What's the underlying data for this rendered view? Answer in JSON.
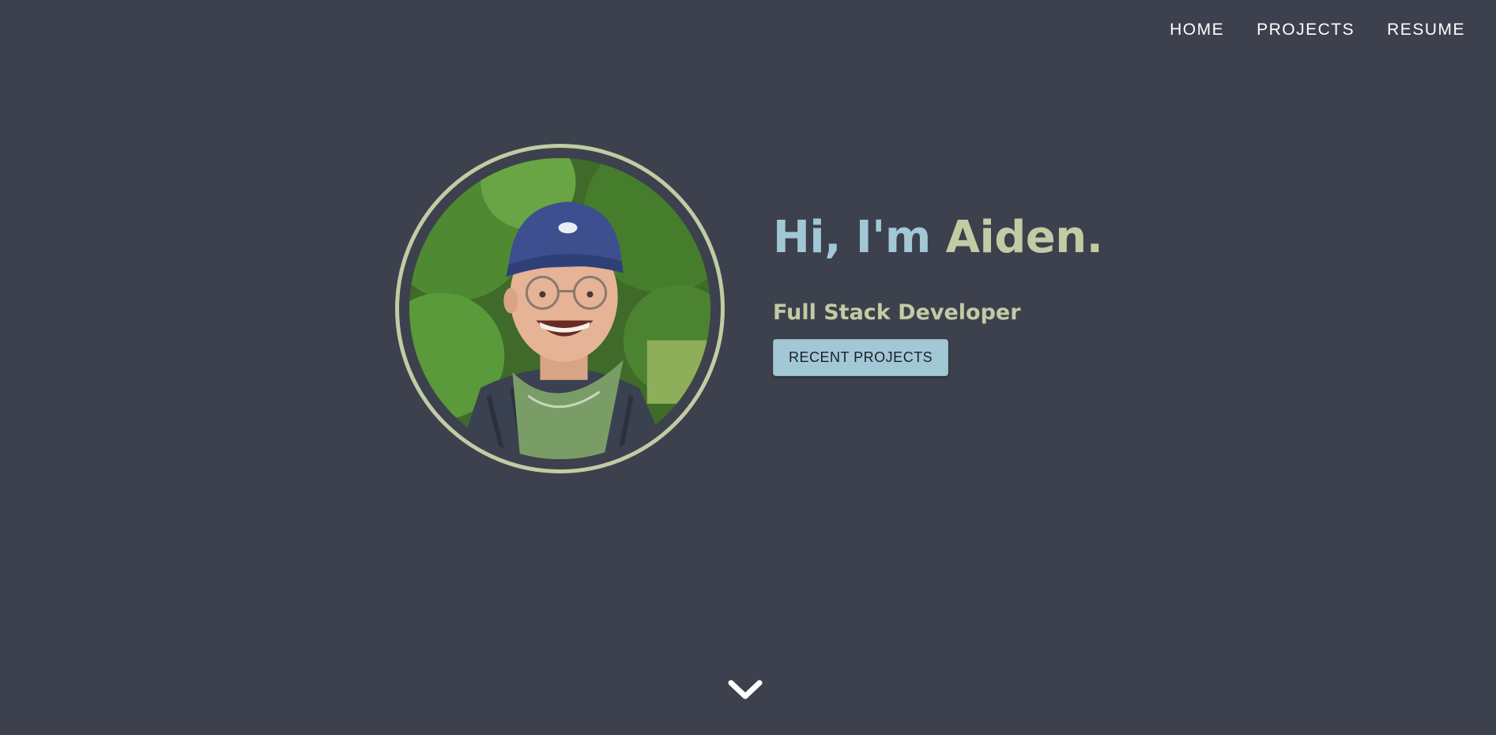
{
  "nav": {
    "items": [
      {
        "label": "HOME"
      },
      {
        "label": "PROJECTS"
      },
      {
        "label": "RESUME"
      }
    ]
  },
  "hero": {
    "greeting_prefix": "Hi, I'm ",
    "greeting_name": "Aiden.",
    "subtitle": "Full Stack Developer",
    "cta_label": "RECENT PROJECTS"
  },
  "icons": {
    "scroll": "chevron-down-icon"
  },
  "colors": {
    "background": "#3d414d",
    "accent_blue": "#a2c8d6",
    "accent_green": "#c1cca4",
    "nav_text": "#ffffff"
  }
}
